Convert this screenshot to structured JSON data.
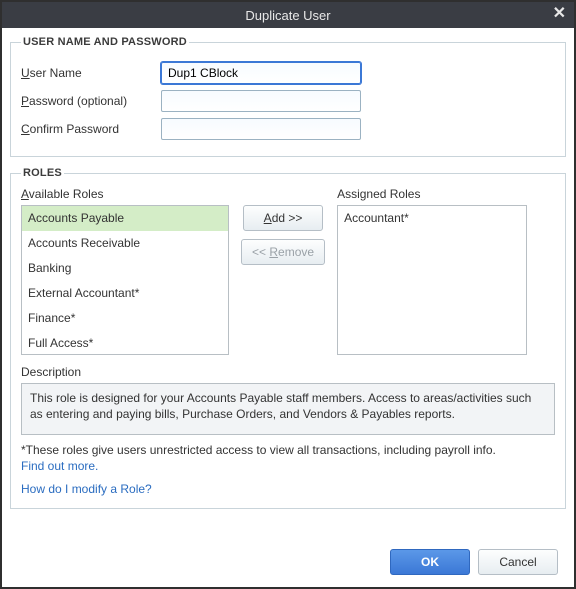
{
  "window": {
    "title": "Duplicate User"
  },
  "section_user": {
    "legend": "USER NAME AND PASSWORD",
    "username_label_pre": "U",
    "username_label_rest": "ser Name",
    "username_value": "Dup1 CBlock",
    "password_label_pre": "P",
    "password_label_rest": "assword (optional)",
    "confirm_label_pre": "C",
    "confirm_label_rest": "onfirm Password"
  },
  "section_roles": {
    "legend": "ROLES",
    "available_label_pre": "A",
    "available_label_rest": "vailable Roles",
    "assigned_label": "Assigned Roles",
    "add_label_pre": "A",
    "add_label_rest": "dd >>",
    "remove_label_pre": "R",
    "remove_label_rest": "emove",
    "remove_prefix": "<< ",
    "available": [
      "Accounts Payable",
      "Accounts Receivable",
      "Banking",
      "External Accountant*",
      "Finance*",
      "Full Access*"
    ],
    "assigned": [
      "Accountant*"
    ],
    "desc_label": "Description",
    "description": "This role is designed for your Accounts Payable staff members. Access to areas/activities such as entering and paying bills, Purchase Orders, and Vendors & Payables reports.",
    "note_text": "*These roles give users unrestricted access to view all transactions, including payroll info.",
    "note_link": "Find out more.",
    "modify_link": "How do I modify a Role?"
  },
  "buttons": {
    "ok": "OK",
    "cancel": "Cancel"
  }
}
